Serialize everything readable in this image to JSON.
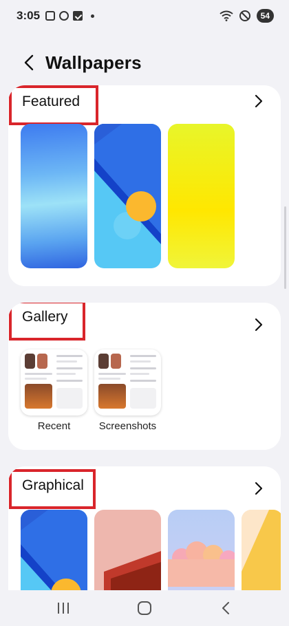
{
  "status_bar": {
    "time": "3:05",
    "battery": "54"
  },
  "header": {
    "title": "Wallpapers",
    "back_icon": "chevron-left-icon"
  },
  "sections": {
    "featured": {
      "title": "Featured"
    },
    "gallery": {
      "title": "Gallery",
      "albums": [
        {
          "label": "Recent"
        },
        {
          "label": "Screenshots"
        }
      ]
    },
    "graphical": {
      "title": "Graphical"
    }
  },
  "colors": {
    "highlight_border": "#d9252b",
    "background": "#f2f2f6"
  }
}
